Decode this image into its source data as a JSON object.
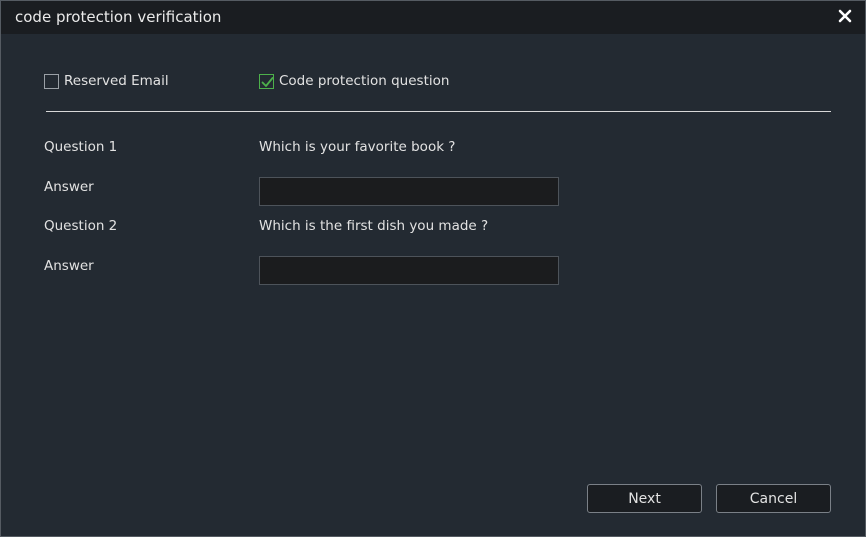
{
  "dialog": {
    "title": "code protection verification",
    "close_icon": "close-icon"
  },
  "options": [
    {
      "label": "Reserved Email",
      "checked": false
    },
    {
      "label": "Code protection question",
      "checked": true
    }
  ],
  "questions": [
    {
      "label": "Question 1",
      "text": "Which is your favorite book ?",
      "answer_label": "Answer",
      "answer_value": ""
    },
    {
      "label": "Question 2",
      "text": "Which is the first dish you made ?",
      "answer_label": "Answer",
      "answer_value": ""
    }
  ],
  "buttons": {
    "next": "Next",
    "cancel": "Cancel"
  },
  "colors": {
    "background": "#232a32",
    "titlebar": "#1a1d21",
    "check_accent": "#4db04b"
  }
}
